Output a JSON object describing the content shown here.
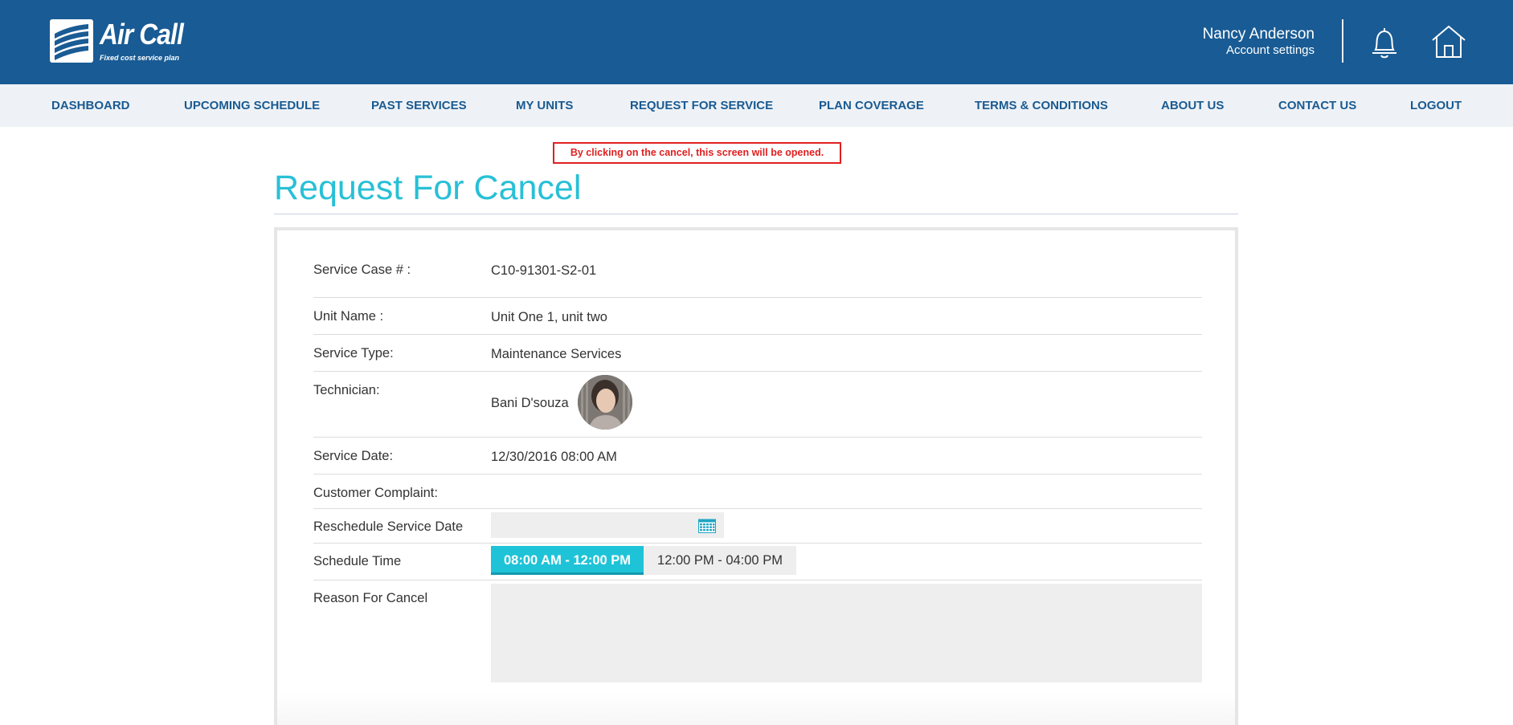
{
  "brand": {
    "name": "Air Call",
    "tagline": "Fixed cost service plan"
  },
  "user": {
    "name": "Nancy Anderson",
    "settings_link": "Account settings"
  },
  "header_icons": [
    "bell-icon",
    "home-icon"
  ],
  "nav": {
    "items": [
      {
        "label": "DASHBOARD"
      },
      {
        "label": "UPCOMING SCHEDULE"
      },
      {
        "label": "PAST SERVICES"
      },
      {
        "label": "MY UNITS"
      },
      {
        "label": "REQUEST FOR SERVICE"
      },
      {
        "label": "PLAN COVERAGE"
      },
      {
        "label": "TERMS & CONDITIONS"
      },
      {
        "label": "ABOUT US"
      },
      {
        "label": "CONTACT US"
      },
      {
        "label": "LOGOUT"
      }
    ]
  },
  "annotation": "By clicking on the cancel, this screen will be opened.",
  "page_title": "Request For Cancel",
  "details": {
    "service_case": {
      "label": "Service Case # :",
      "value": "C10-91301-S2-01"
    },
    "unit_name": {
      "label": "Unit Name :",
      "value": "Unit One 1, unit two"
    },
    "service_type": {
      "label": "Service Type:",
      "value": "Maintenance Services"
    },
    "technician": {
      "label": "Technician:",
      "value": "Bani D'souza"
    },
    "service_date": {
      "label": "Service Date:",
      "value": "12/30/2016 08:00 AM"
    },
    "customer_complaint": {
      "label": "Customer Complaint:",
      "value": ""
    }
  },
  "form": {
    "reschedule_label": "Reschedule Service Date",
    "reschedule_value": "",
    "schedule_time_label": "Schedule Time",
    "time_slots": [
      {
        "label": "08:00 AM - 12:00 PM",
        "selected": true
      },
      {
        "label": "12:00 PM - 04:00 PM",
        "selected": false
      }
    ],
    "reason_label": "Reason For Cancel",
    "reason_value": ""
  },
  "colors": {
    "header_bg": "#195b94",
    "nav_bg": "#eef2f6",
    "nav_text": "#1a5a91",
    "accent": "#1fc3d7",
    "title": "#28c0d6",
    "annotation": "#e02020"
  }
}
